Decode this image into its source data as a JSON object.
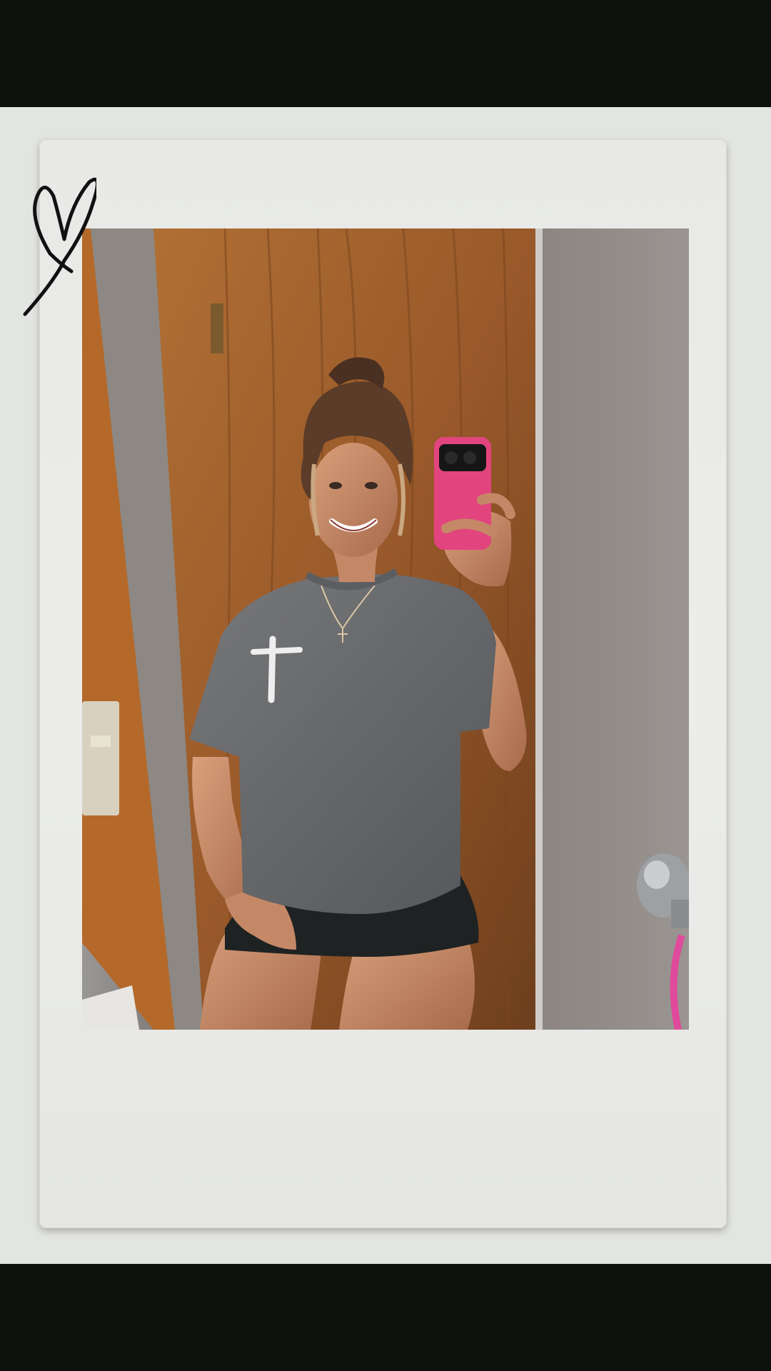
{
  "frame": {
    "style": "instant-photo",
    "colors": {
      "letterbox": "#0f110d",
      "paper": "#e3e5e2",
      "polaroid": "#ecedeb",
      "door_wood": "#a0642c",
      "wall": "#8f8a86",
      "shirt": "#6b6c6e",
      "phone_case": "#e2457e",
      "shorts": "#1f2222",
      "skin": "#c98e6c",
      "hair": "#5a3c28"
    }
  },
  "doodle": {
    "icon": "heart-doodle-icon"
  },
  "photo": {
    "subject": "mirror-selfie",
    "shirt_graphic_icon": "cross-icon"
  }
}
